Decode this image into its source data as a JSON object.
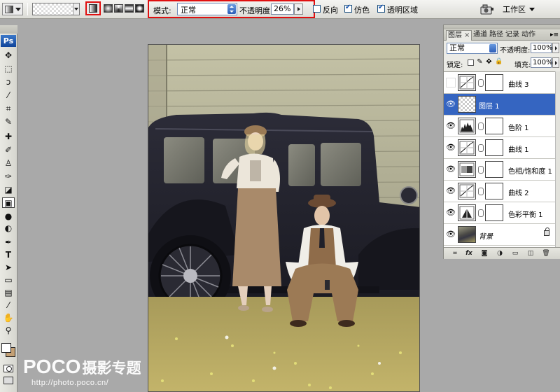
{
  "options_bar": {
    "mode_label": "模式:",
    "mode_value": "正常",
    "opacity_label": "不透明度:",
    "opacity_value": "26%",
    "reverse_label": "反向",
    "reverse_checked": false,
    "dither_label": "仿色",
    "dither_checked": true,
    "transparency_label": "透明区域",
    "transparency_checked": true,
    "workspace_label": "工作区",
    "highlight_color": "#e01010"
  },
  "toolbox": {
    "logo": "Ps",
    "active_tool": "gradient-tool",
    "foreground_color": "#ffffff",
    "background_color": "#c4a074"
  },
  "layers_panel": {
    "tabs": [
      "图层",
      "通道",
      "路径",
      "记录",
      "动作"
    ],
    "active_tab": "图层",
    "blend_mode": "正常",
    "opacity_label": "不透明度:",
    "opacity_value": "100%",
    "lock_label": "锁定:",
    "fill_label": "填充:",
    "fill_value": "100%",
    "selected_color": "#3565c1",
    "layers": [
      {
        "name": "曲线 3",
        "type": "curves",
        "visible": false
      },
      {
        "name": "图层 1",
        "type": "pixel",
        "visible": true,
        "selected": true
      },
      {
        "name": "色阶 1",
        "type": "levels",
        "visible": true
      },
      {
        "name": "曲线 1",
        "type": "curves",
        "visible": true
      },
      {
        "name": "色相/饱和度 1",
        "type": "hue-saturation",
        "visible": true
      },
      {
        "name": "曲线 2",
        "type": "curves",
        "visible": true
      },
      {
        "name": "色彩平衡 1",
        "type": "color-balance",
        "visible": true
      },
      {
        "name": "背景",
        "type": "background",
        "visible": true,
        "locked": true
      }
    ],
    "bottom_icons": [
      "link-icon",
      "fx-icon",
      "mask-icon",
      "adjustment-icon",
      "group-icon",
      "new-layer-icon",
      "trash-icon"
    ]
  },
  "watermark": {
    "brand": "POCO",
    "title": "摄影专题",
    "url": "http://photo.poco.cn/"
  }
}
